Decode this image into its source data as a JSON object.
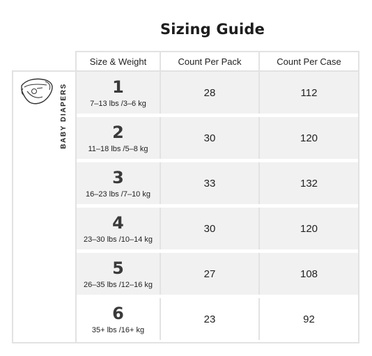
{
  "title": "Sizing Guide",
  "headers": {
    "size_weight": "Size & Weight",
    "count_pack": "Count Per Pack",
    "count_case": "Count Per Case"
  },
  "category": {
    "label": "BABY DIAPERS",
    "icon": "diaper-icon"
  },
  "rows": [
    {
      "size": "1",
      "weight": "7–13 lbs /3–6 kg",
      "pack": "28",
      "case": "112"
    },
    {
      "size": "2",
      "weight": "11–18 lbs /5–8 kg",
      "pack": "30",
      "case": "120"
    },
    {
      "size": "3",
      "weight": "16–23 lbs /7–10 kg",
      "pack": "33",
      "case": "132"
    },
    {
      "size": "4",
      "weight": "23–30 lbs /10–14 kg",
      "pack": "30",
      "case": "120"
    },
    {
      "size": "5",
      "weight": "26–35 lbs /12–16 kg",
      "pack": "27",
      "case": "108"
    },
    {
      "size": "6",
      "weight": "35+ lbs /16+ kg",
      "pack": "23",
      "case": "92"
    }
  ],
  "colors": {
    "shaded_row": "#f1f1f1",
    "border": "#e2e2e2",
    "text": "#222222"
  }
}
